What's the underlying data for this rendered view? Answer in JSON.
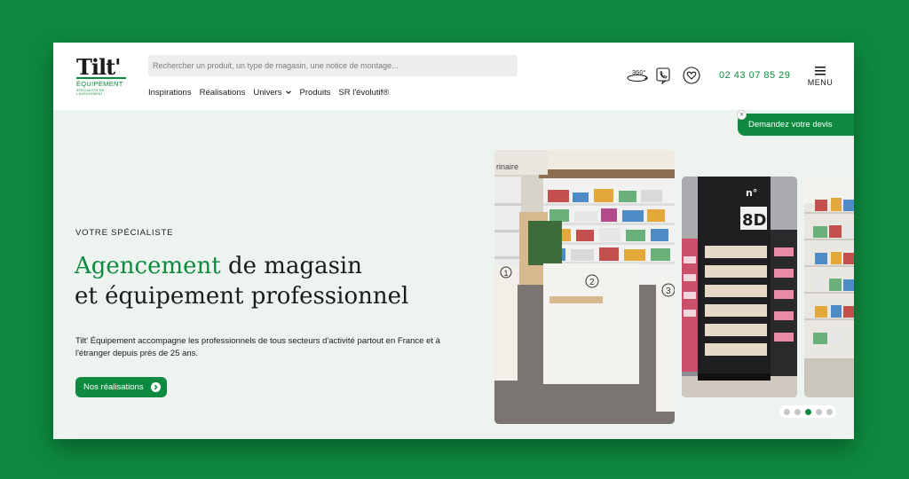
{
  "brand": {
    "logo_mark": "Tilt'",
    "logo_sub": "ÉQUIPEMENT",
    "logo_tagline": "SPÉCIALISTE DE L'AGENCEMENT"
  },
  "search": {
    "placeholder": "Rechercher un produit, un type de magasin, une notice de montage..."
  },
  "nav": {
    "items": [
      {
        "label": "Inspirations"
      },
      {
        "label": "Réalisations"
      },
      {
        "label": "Univers"
      },
      {
        "label": "Produits"
      },
      {
        "label": "SR l'évolutif®"
      }
    ]
  },
  "header": {
    "icons": [
      "360-view-icon",
      "phone-contact-icon",
      "heart-favorites-icon"
    ],
    "phone": "02 43 07 85 29",
    "menu_label": "MENU"
  },
  "devis": {
    "label": "Demandez votre devis",
    "close": "×"
  },
  "hero": {
    "eyebrow": "VOTRE SPÉCIALISTE",
    "headline_accent": "Agencement",
    "headline_rest": " de magasin",
    "headline_line2": "et équipement professionnel",
    "description": "Tilt' Équipement accompagne les professionnels de tous secteurs d'activité partout en France et à l'étranger depuis près de 25 ans.",
    "cta_label": "Nos réalisations"
  },
  "carousel": {
    "slide1_sign": "rinaire",
    "counter_numbers": [
      "1",
      "2",
      "3"
    ],
    "slide2_sign": "8D",
    "slide2_sign_small": "n°",
    "active_dot": 3,
    "dot_count": 5
  },
  "colors": {
    "accent": "#0d8a3f",
    "background": "#edf3ef",
    "text": "#1b1b1b"
  }
}
